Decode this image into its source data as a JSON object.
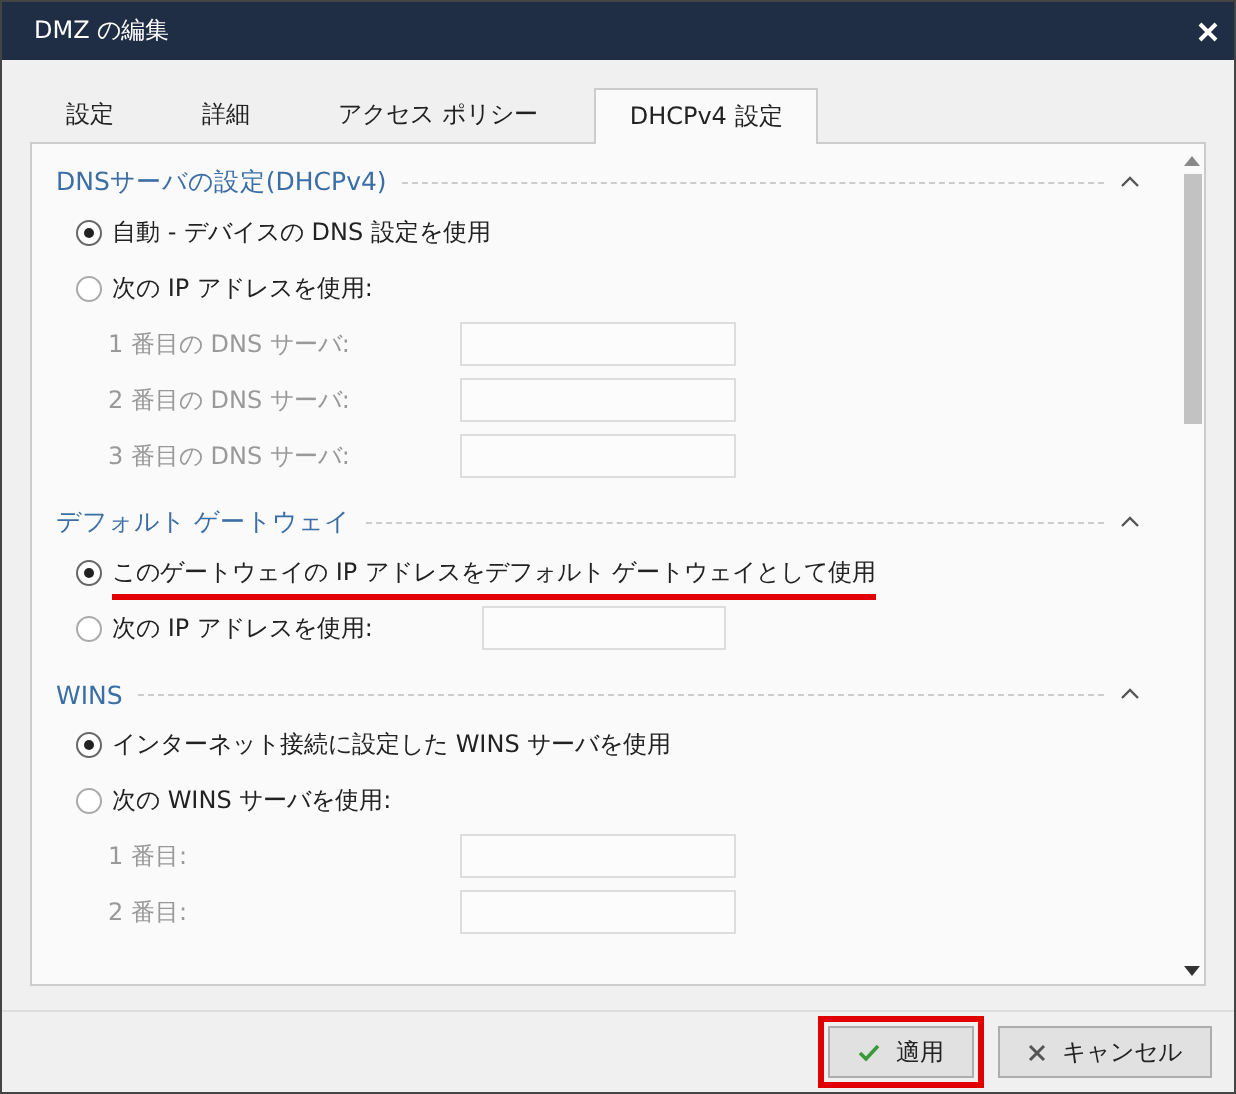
{
  "window": {
    "title": "DMZ の編集"
  },
  "tabs": [
    {
      "label": "設定",
      "selected": false
    },
    {
      "label": "詳細",
      "selected": false
    },
    {
      "label": "アクセス ポリシー",
      "selected": false
    },
    {
      "label": "DHCPv4 設定",
      "selected": true
    }
  ],
  "sections": [
    {
      "title": "DNSサーバの設定(DHCPv4)",
      "expanded": true,
      "items": [
        {
          "kind": "radio",
          "label": "自動 - デバイスの DNS 設定を使用",
          "selected": true,
          "highlighted": false
        },
        {
          "kind": "radio",
          "label": "次の IP アドレスを使用:",
          "selected": false,
          "highlighted": false
        },
        {
          "kind": "field",
          "label": "1 番目の DNS サーバ:",
          "disabled": true
        },
        {
          "kind": "field",
          "label": "2 番目の DNS サーバ:",
          "disabled": true
        },
        {
          "kind": "field",
          "label": "3 番目の DNS サーバ:",
          "disabled": true
        }
      ]
    },
    {
      "title": "デフォルト ゲートウェイ",
      "expanded": true,
      "items": [
        {
          "kind": "radio",
          "label": "このゲートウェイの IP アドレスをデフォルト ゲートウェイとして使用",
          "selected": true,
          "highlighted": true
        },
        {
          "kind": "radio_field",
          "label": "次の IP アドレスを使用:",
          "selected": false,
          "highlighted": false,
          "disabled": true
        }
      ]
    },
    {
      "title": "WINS",
      "expanded": true,
      "items": [
        {
          "kind": "radio",
          "label": "インターネット接続に設定した WINS サーバを使用",
          "selected": true,
          "highlighted": false
        },
        {
          "kind": "radio",
          "label": "次の WINS サーバを使用:",
          "selected": false,
          "highlighted": false
        },
        {
          "kind": "field",
          "label": "1 番目:",
          "disabled": true
        },
        {
          "kind": "field",
          "label": "2 番目:",
          "disabled": true
        }
      ]
    }
  ],
  "buttons": [
    {
      "kind": "apply",
      "label": "適用",
      "highlighted": true
    },
    {
      "kind": "cancel",
      "label": "キャンセル",
      "highlighted": false
    }
  ]
}
